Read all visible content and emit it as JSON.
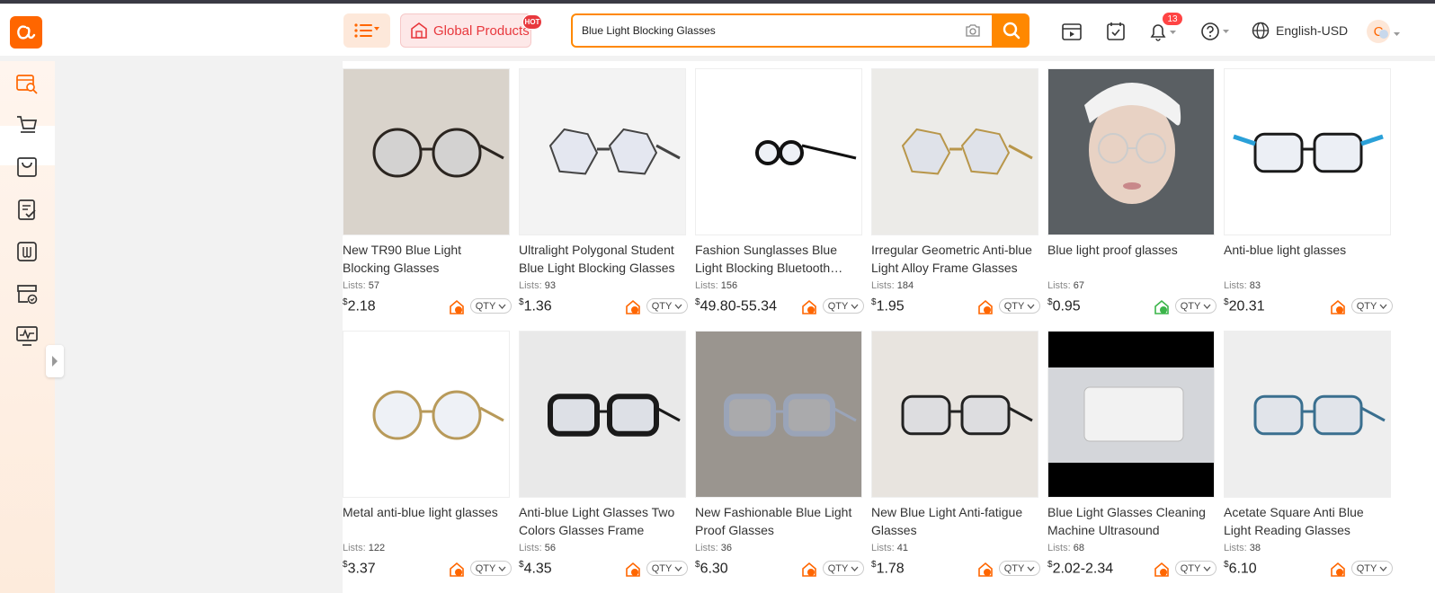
{
  "header": {
    "global_products": "Global Products",
    "hot_label": "HOT",
    "search_value": "Blue Light Blocking Glasses",
    "notification_count": "13",
    "language": "English-USD",
    "avatar_letter": "C"
  },
  "colors": {
    "accent": "#ff8800",
    "hot": "#e8383d",
    "brand": "#ff6600"
  },
  "products": [
    {
      "name": "New TR90 Blue Light Blocking Glasses",
      "lists_label": "Lists:",
      "lists": "57",
      "currency": "$",
      "price": "2.18",
      "shop": "orange"
    },
    {
      "name": "Ultralight Polygonal Student Blue Light Blocking Glasses",
      "lists_label": "Lists:",
      "lists": "93",
      "currency": "$",
      "price": "1.36",
      "shop": "orange"
    },
    {
      "name": "Fashion Sunglasses Blue Light Blocking Bluetooth Glasses",
      "lists_label": "Lists:",
      "lists": "156",
      "currency": "$",
      "price": "49.80-55.34",
      "shop": "orange"
    },
    {
      "name": "Irregular Geometric Anti-blue Light Alloy Frame Glasses",
      "lists_label": "Lists:",
      "lists": "184",
      "currency": "$",
      "price": "1.95",
      "shop": "orange"
    },
    {
      "name": "Blue light proof glasses",
      "lists_label": "Lists:",
      "lists": "67",
      "currency": "$",
      "price": "0.95",
      "shop": "green"
    },
    {
      "name": "Anti-blue light glasses",
      "lists_label": "Lists:",
      "lists": "83",
      "currency": "$",
      "price": "20.31",
      "shop": "orange"
    },
    {
      "name": "Metal anti-blue light glasses",
      "lists_label": "Lists:",
      "lists": "122",
      "currency": "$",
      "price": "3.37",
      "shop": "orange"
    },
    {
      "name": "Anti-blue Light Glasses Two Colors Glasses Frame",
      "lists_label": "Lists:",
      "lists": "56",
      "currency": "$",
      "price": "4.35",
      "shop": "orange"
    },
    {
      "name": "New Fashionable Blue Light Proof Glasses",
      "lists_label": "Lists:",
      "lists": "36",
      "currency": "$",
      "price": "6.30",
      "shop": "orange"
    },
    {
      "name": "New Blue Light Anti-fatigue Glasses",
      "lists_label": "Lists:",
      "lists": "41",
      "currency": "$",
      "price": "1.78",
      "shop": "orange"
    },
    {
      "name": "Blue Light Glasses Cleaning Machine Ultrasound",
      "lists_label": "Lists:",
      "lists": "68",
      "currency": "$",
      "price": "2.02-2.34",
      "shop": "orange"
    },
    {
      "name": "Acetate Square Anti Blue Light Reading Glasses",
      "lists_label": "Lists:",
      "lists": "38",
      "currency": "$",
      "price": "6.10",
      "shop": "orange"
    }
  ],
  "qty_label": "QTY"
}
